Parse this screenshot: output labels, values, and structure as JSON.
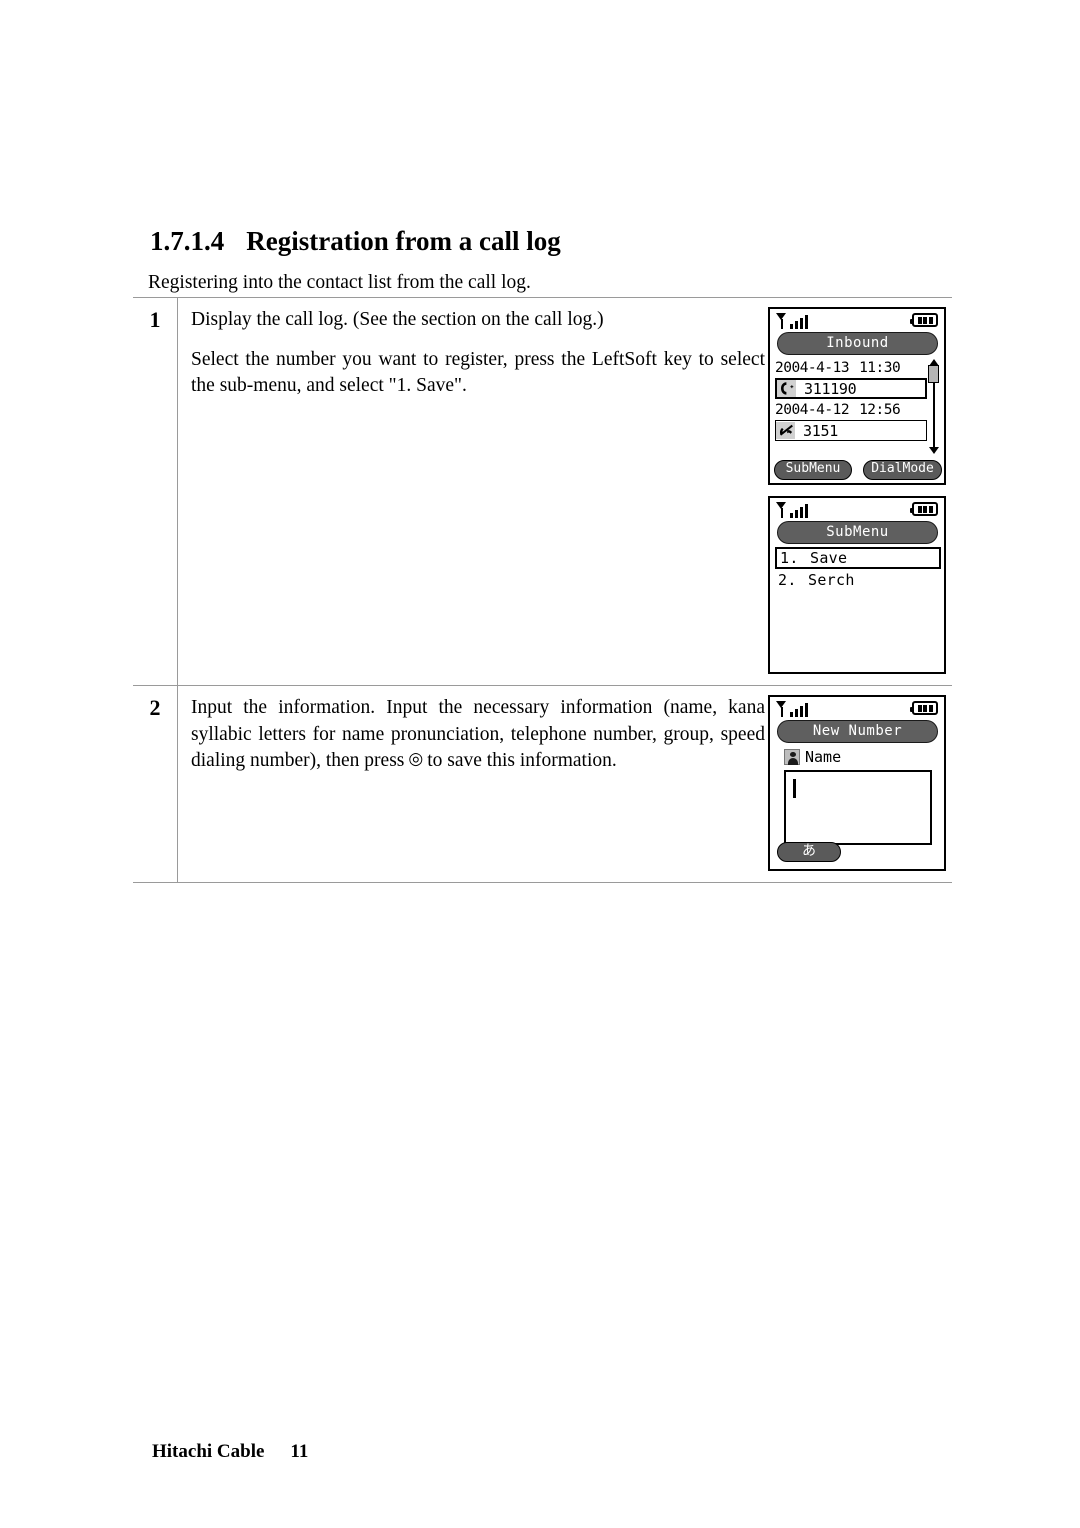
{
  "heading": {
    "number": "1.7.1.4",
    "title": "Registration from a call log"
  },
  "lead_text": "Registering into the contact list from the call log.",
  "steps": [
    {
      "number": "1",
      "paragraphs": [
        "Display the call log. (See the section on the call log.)",
        "Select the number you want to register, press the LeftSoft key to select the sub-menu, and select \"1. Save\"."
      ]
    },
    {
      "number": "2",
      "text_before": "Input the information. Input the necessary information (name, kana syllabic letters for name pronunciation, telephone number, group, speed dialing number), then press",
      "button_glyph": "◎",
      "text_after": "to save this information."
    }
  ],
  "screens": {
    "call_log": {
      "title": "Inbound",
      "entries": [
        {
          "date": "2004-4-13",
          "time": "11:30",
          "number": "311190",
          "icon": "incoming-call-icon",
          "selected": true
        },
        {
          "date": "2004-4-12",
          "time": "12:56",
          "number": "3151",
          "icon": "missed-call-icon",
          "selected": false
        }
      ],
      "softkeys": {
        "left": "SubMenu",
        "right": "DialMode"
      }
    },
    "sub_menu": {
      "title": "SubMenu",
      "items": [
        {
          "index": "1.",
          "label": "Save",
          "selected": true
        },
        {
          "index": "2.",
          "label": "Serch",
          "selected": false
        }
      ]
    },
    "new_number": {
      "title": "New Number",
      "field_label": "Name",
      "field_value": "",
      "ime_key": "あ"
    }
  },
  "footer": {
    "company": "Hitachi Cable",
    "page": "11"
  }
}
